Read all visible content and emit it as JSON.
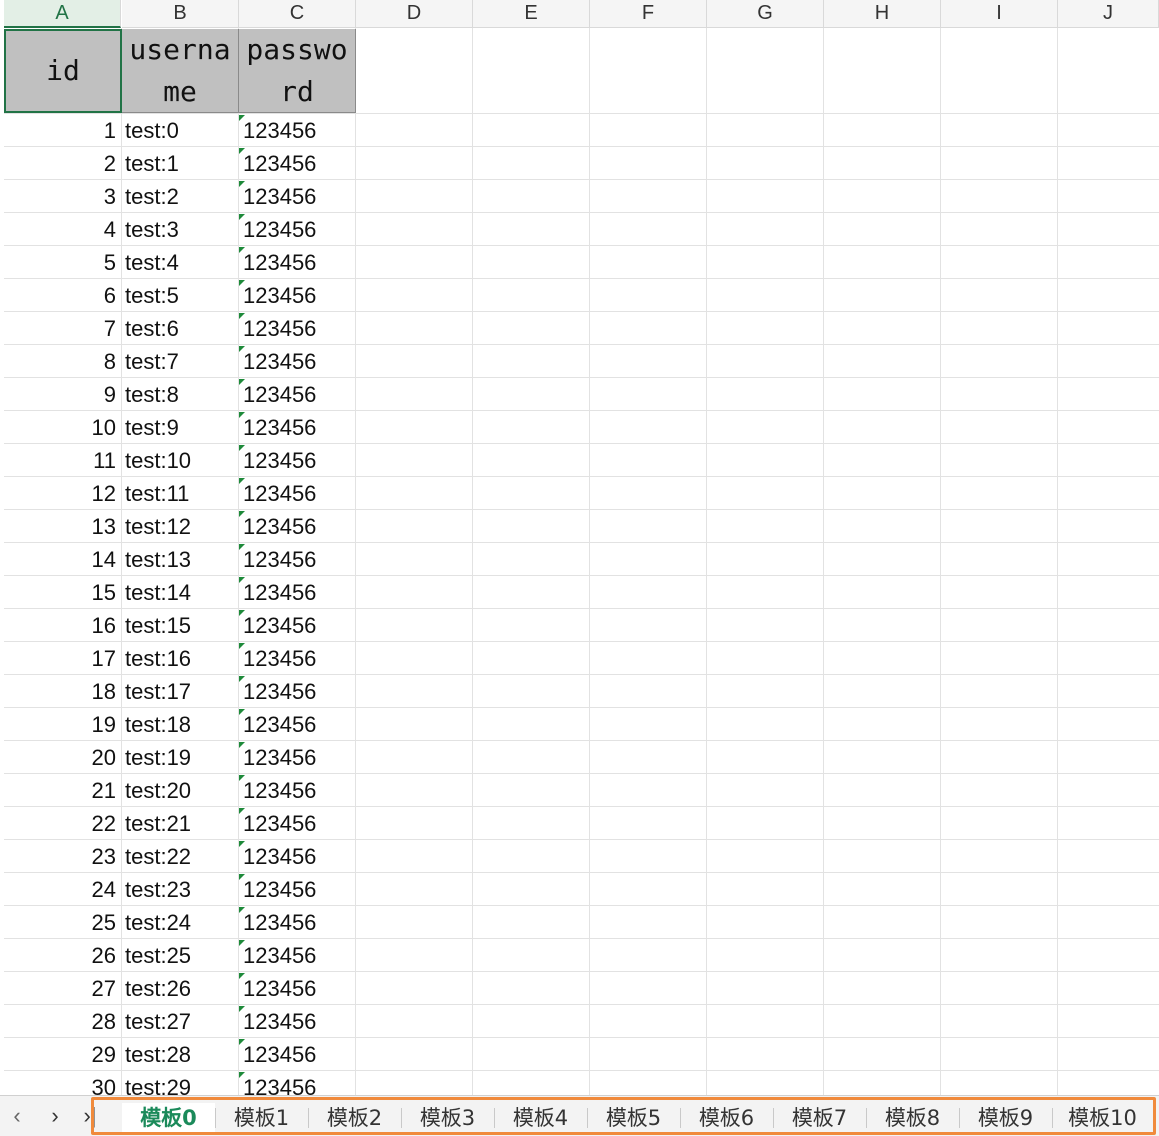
{
  "columns": [
    "A",
    "B",
    "C",
    "D",
    "E",
    "F",
    "G",
    "H",
    "I",
    "J"
  ],
  "header_cells": [
    "id",
    "username",
    "password"
  ],
  "rows": [
    {
      "id": "1",
      "username": "test:0",
      "password": "123456"
    },
    {
      "id": "2",
      "username": "test:1",
      "password": "123456"
    },
    {
      "id": "3",
      "username": "test:2",
      "password": "123456"
    },
    {
      "id": "4",
      "username": "test:3",
      "password": "123456"
    },
    {
      "id": "5",
      "username": "test:4",
      "password": "123456"
    },
    {
      "id": "6",
      "username": "test:5",
      "password": "123456"
    },
    {
      "id": "7",
      "username": "test:6",
      "password": "123456"
    },
    {
      "id": "8",
      "username": "test:7",
      "password": "123456"
    },
    {
      "id": "9",
      "username": "test:8",
      "password": "123456"
    },
    {
      "id": "10",
      "username": "test:9",
      "password": "123456"
    },
    {
      "id": "11",
      "username": "test:10",
      "password": "123456"
    },
    {
      "id": "12",
      "username": "test:11",
      "password": "123456"
    },
    {
      "id": "13",
      "username": "test:12",
      "password": "123456"
    },
    {
      "id": "14",
      "username": "test:13",
      "password": "123456"
    },
    {
      "id": "15",
      "username": "test:14",
      "password": "123456"
    },
    {
      "id": "16",
      "username": "test:15",
      "password": "123456"
    },
    {
      "id": "17",
      "username": "test:16",
      "password": "123456"
    },
    {
      "id": "18",
      "username": "test:17",
      "password": "123456"
    },
    {
      "id": "19",
      "username": "test:18",
      "password": "123456"
    },
    {
      "id": "20",
      "username": "test:19",
      "password": "123456"
    },
    {
      "id": "21",
      "username": "test:20",
      "password": "123456"
    },
    {
      "id": "22",
      "username": "test:21",
      "password": "123456"
    },
    {
      "id": "23",
      "username": "test:22",
      "password": "123456"
    },
    {
      "id": "24",
      "username": "test:23",
      "password": "123456"
    },
    {
      "id": "25",
      "username": "test:24",
      "password": "123456"
    },
    {
      "id": "26",
      "username": "test:25",
      "password": "123456"
    },
    {
      "id": "27",
      "username": "test:26",
      "password": "123456"
    },
    {
      "id": "28",
      "username": "test:27",
      "password": "123456"
    },
    {
      "id": "29",
      "username": "test:28",
      "password": "123456"
    },
    {
      "id": "30",
      "username": "test:29",
      "password": "123456"
    }
  ],
  "selected_column": "A",
  "nav": {
    "prev": "‹",
    "next": "›",
    "last": "›|"
  },
  "sheet_tabs": [
    "模板0",
    "模板1",
    "模板2",
    "模板3",
    "模板4",
    "模板5",
    "模板6",
    "模板7",
    "模板8",
    "模板9",
    "模板10"
  ],
  "active_tab": "模板0",
  "colors": {
    "accent": "#217346",
    "tab_highlight": "#f08a3c",
    "header_fill": "#c0c0c0",
    "text_comment_marker": "#1e8a3a"
  }
}
